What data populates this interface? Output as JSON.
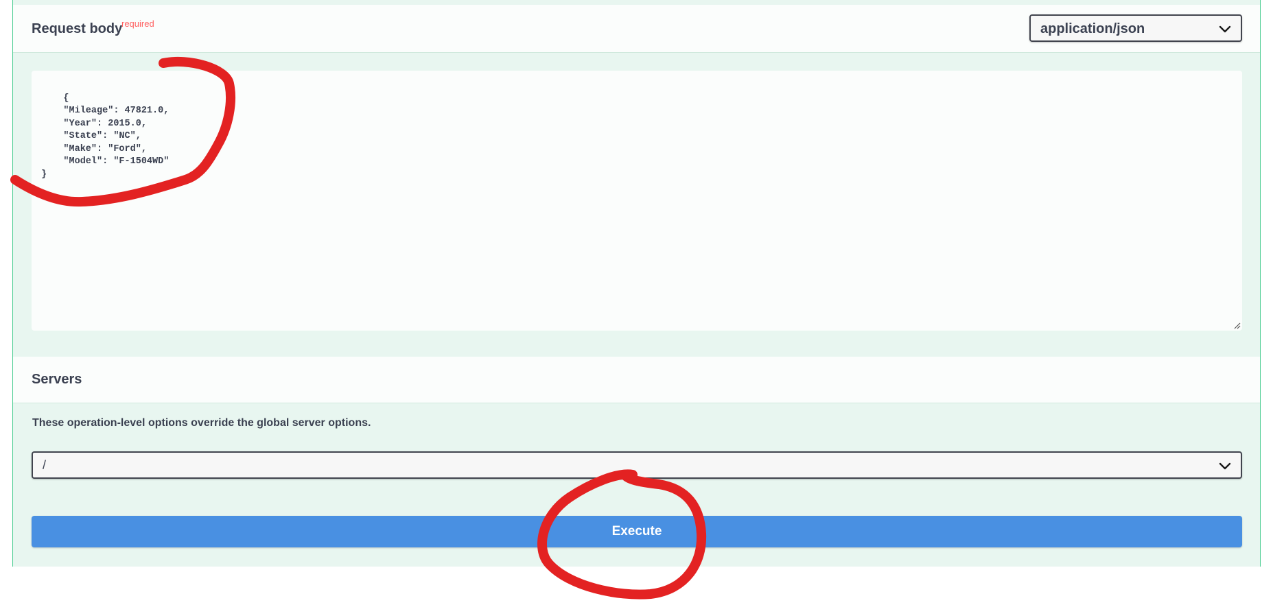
{
  "request_body": {
    "title": "Request body",
    "required_label": "required",
    "content_type": "application/json",
    "json_text": "{\n    \"Mileage\": 47821.0,\n    \"Year\": 2015.0,\n    \"State\": \"NC\",\n    \"Make\": \"Ford\",\n    \"Model\": \"F-1504WD\"\n}"
  },
  "servers": {
    "title": "Servers",
    "description": "These operation-level options override the global server options.",
    "selected": "/"
  },
  "execute": {
    "label": "Execute"
  },
  "icons": {
    "chevron": "chevron-down-icon",
    "resize": "resize-handle-icon",
    "annotation": "red-marker-annotation"
  },
  "colors": {
    "accent": "#4990e2",
    "required": "#ff6060",
    "panel": "#e8f6f0",
    "panel_border": "#49cc90",
    "annotation": "#e32222"
  }
}
